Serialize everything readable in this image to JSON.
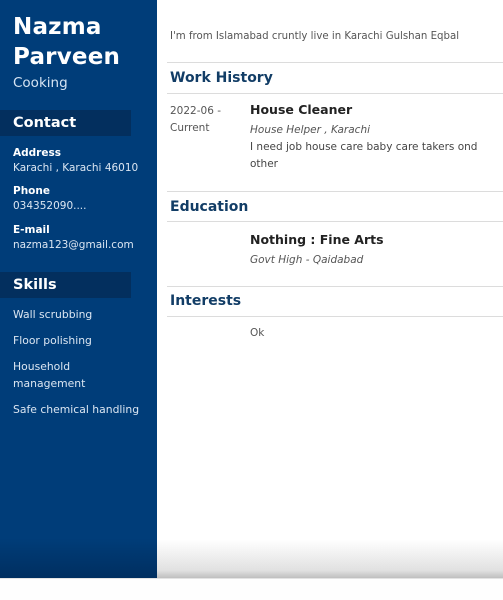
{
  "header": {
    "first_name": "Nazma",
    "last_name": "Parveen",
    "profession": "Cooking"
  },
  "contact": {
    "heading": "Contact",
    "items": [
      {
        "label": "Address",
        "value": "Karachi , Karachi 46010"
      },
      {
        "label": "Phone",
        "value": "034352090...."
      },
      {
        "label": "E-mail",
        "value": "nazma123@gmail.com"
      }
    ]
  },
  "skills": {
    "heading": "Skills",
    "items": [
      "Wall scrubbing",
      "Floor polishing",
      "Household management",
      "Safe chemical handling"
    ]
  },
  "summary": "I'm from Islamabad cruntly live in Karachi Gulshan Eqbal",
  "work_history": {
    "heading": "Work History",
    "entries": [
      {
        "date_start": "2022-06 -",
        "date_end": "Current",
        "title": "House Cleaner",
        "employer": "House Helper , Karachi",
        "description": "I need job house care baby care takers ond other"
      }
    ]
  },
  "education": {
    "heading": "Education",
    "entries": [
      {
        "title": "Nothing : Fine Arts",
        "school": "Govt High - Qaidabad"
      }
    ]
  },
  "interests": {
    "heading": "Interests",
    "items": [
      "Ok"
    ]
  },
  "colors": {
    "sidebar": "#003d79",
    "sidebar_heading": "#032f5e",
    "section_title": "#123d66"
  }
}
